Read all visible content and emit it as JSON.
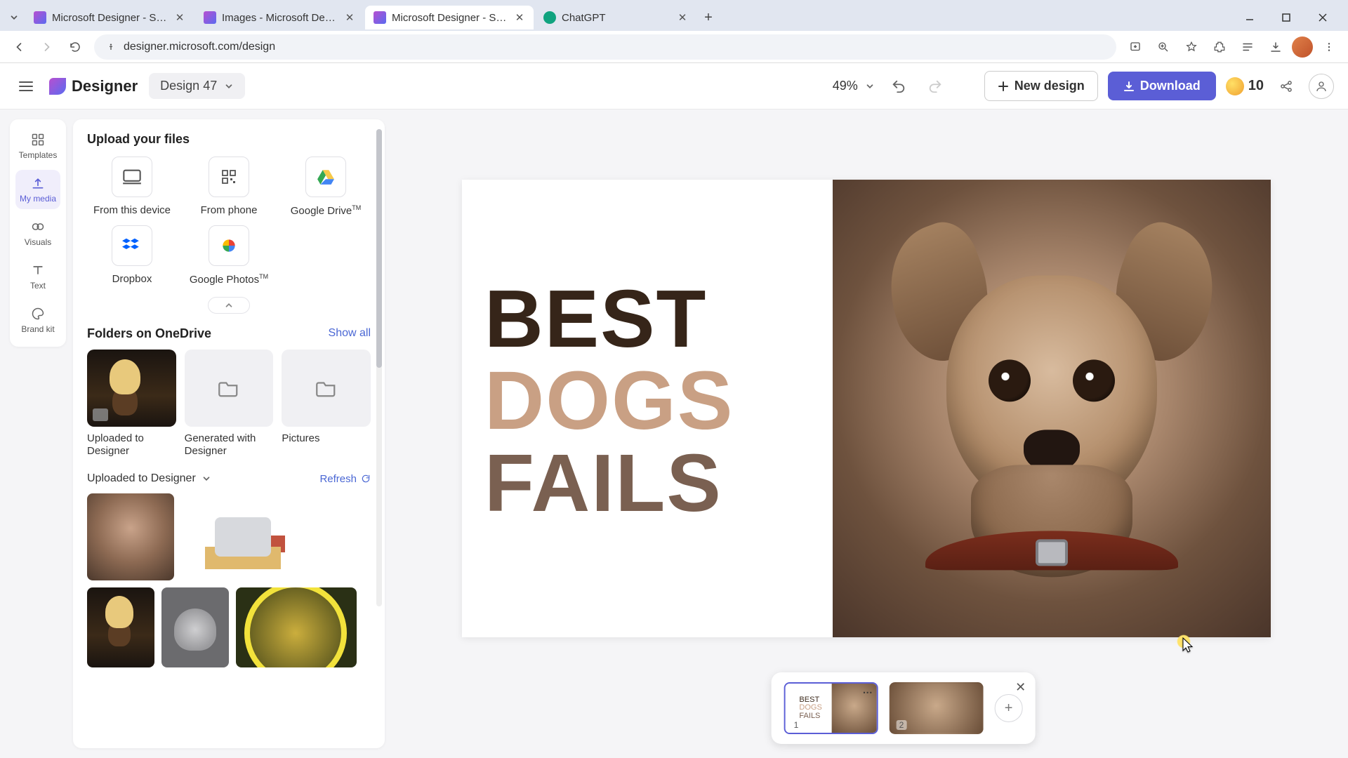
{
  "browser": {
    "tabs": [
      {
        "title": "Microsoft Designer - Stunning"
      },
      {
        "title": "Images - Microsoft Designer"
      },
      {
        "title": "Microsoft Designer - Stunning"
      },
      {
        "title": "ChatGPT"
      }
    ],
    "url": "designer.microsoft.com/design"
  },
  "header": {
    "brand": "Designer",
    "design_name": "Design 47",
    "zoom": "49%",
    "new_design": "New design",
    "download": "Download",
    "coins": "10"
  },
  "rail": {
    "items": [
      {
        "label": "Templates"
      },
      {
        "label": "My media"
      },
      {
        "label": "Visuals"
      },
      {
        "label": "Text"
      },
      {
        "label": "Brand kit"
      }
    ]
  },
  "panel": {
    "upload_title": "Upload your files",
    "sources": [
      {
        "label": "From this device"
      },
      {
        "label": "From phone"
      },
      {
        "label": "Google Drive",
        "suffix": "TM"
      },
      {
        "label": "Dropbox"
      },
      {
        "label": "Google Photos",
        "suffix": "TM"
      }
    ],
    "folders_title": "Folders on OneDrive",
    "show_all": "Show all",
    "folders": [
      {
        "label": "Uploaded to Designer"
      },
      {
        "label": "Generated with Designer"
      },
      {
        "label": "Pictures"
      }
    ],
    "uploaded_section": "Uploaded to Designer",
    "refresh": "Refresh"
  },
  "canvas": {
    "text_line1": "BEST",
    "text_line2": "DOGS",
    "text_line3": "FAILS"
  },
  "pages": {
    "page1_num": "1",
    "page2_num": "2",
    "thumb_text_l1": "BEST",
    "thumb_text_l2": "DOGS",
    "thumb_text_l3": "FAILS"
  }
}
